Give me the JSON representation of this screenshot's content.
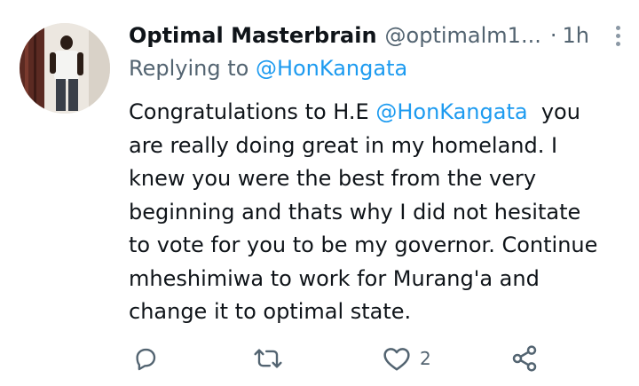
{
  "tweet": {
    "author_name": "Optimal Masterbrain",
    "author_handle": "@optimalm1...",
    "separator": "·",
    "time": "1h",
    "replying_prefix": "Replying to",
    "replying_handle": "@HonKangata",
    "text_line1_a": "Congratulations to H.E",
    "text_line1_mention": "@HonKangata",
    "text_line1_b": "you",
    "text_lines": [
      "are really doing great in my homeland. I",
      "knew you were the best from the very",
      "beginning and thats why I did not hesitate",
      "to vote for you to be my governor. Continue",
      "mheshimiwa to work for Murang'a and",
      "change it to optimal state."
    ],
    "like_count": "2"
  },
  "icons": {
    "reply": "reply-icon",
    "retweet": "retweet-icon",
    "like": "heart-icon",
    "share": "share-icon",
    "more": "more-vertical-icon"
  },
  "colors": {
    "text": "#0f1419",
    "secondary": "#536471",
    "link": "#1d9bf0"
  }
}
